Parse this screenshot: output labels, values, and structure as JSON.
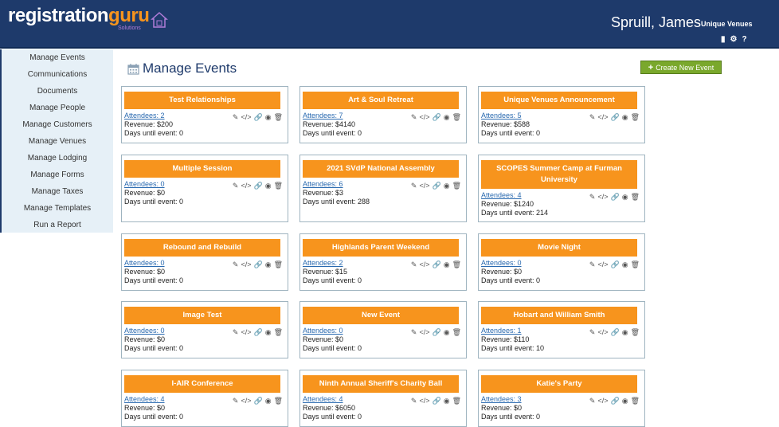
{
  "header": {
    "logo_main": "registration",
    "logo_accent": "guru",
    "logo_sub": "Solutions",
    "user_name": "Spruill, James",
    "organization": "Unique Venues",
    "icons": [
      "document-icon",
      "gear-icon",
      "help-icon"
    ]
  },
  "sidebar": {
    "items": [
      {
        "label": "Manage Events"
      },
      {
        "label": "Communications"
      },
      {
        "label": "Documents"
      },
      {
        "label": "Manage People"
      },
      {
        "label": "Manage Customers"
      },
      {
        "label": "Manage Venues"
      },
      {
        "label": "Manage Lodging"
      },
      {
        "label": "Manage Forms"
      },
      {
        "label": "Manage Taxes"
      },
      {
        "label": "Manage Templates"
      },
      {
        "label": "Run a Report"
      }
    ]
  },
  "main": {
    "title": "Manage Events",
    "create_label": "Create New Event",
    "card_icons": [
      "edit-icon",
      "code-icon",
      "link-icon",
      "binoculars-icon",
      "trash-icon"
    ],
    "events": [
      {
        "title": "Test Relationships",
        "attendees": "Attendees: 2",
        "revenue": "Revenue: $200",
        "days": "Days until event: 0"
      },
      {
        "title": "Art & Soul Retreat",
        "attendees": "Attendees: 7",
        "revenue": "Revenue: $4140",
        "days": "Days until event: 0"
      },
      {
        "title": "Unique Venues Announcement",
        "attendees": "Attendees: 5",
        "revenue": "Revenue: $588",
        "days": "Days until event: 0"
      },
      {
        "title": "Multiple Session",
        "attendees": "Attendees: 0",
        "revenue": "Revenue: $0",
        "days": "Days until event: 0"
      },
      {
        "title": "2021 SVdP National Assembly",
        "attendees": "Attendees: 6",
        "revenue": "Revenue: $3",
        "days": "Days until event: 288"
      },
      {
        "title": "SCOPES Summer Camp at Furman University",
        "attendees": "Attendees: 4",
        "revenue": "Revenue: $1240",
        "days": "Days until event: 214"
      },
      {
        "title": "Rebound and Rebuild",
        "attendees": "Attendees: 0",
        "revenue": "Revenue: $0",
        "days": "Days until event: 0"
      },
      {
        "title": "Highlands Parent Weekend",
        "attendees": "Attendees: 2",
        "revenue": "Revenue: $15",
        "days": "Days until event: 0"
      },
      {
        "title": "Movie Night",
        "attendees": "Attendees: 0",
        "revenue": "Revenue: $0",
        "days": "Days until event: 0"
      },
      {
        "title": "Image Test",
        "attendees": "Attendees: 0",
        "revenue": "Revenue: $0",
        "days": "Days until event: 0"
      },
      {
        "title": "New Event",
        "attendees": "Attendees: 0",
        "revenue": "Revenue: $0",
        "days": "Days until event: 0"
      },
      {
        "title": "Hobart and William Smith",
        "attendees": "Attendees: 1",
        "revenue": "Revenue: $110",
        "days": "Days until event: 10"
      },
      {
        "title": "I-AIR Conference",
        "attendees": "Attendees: 4",
        "revenue": "Revenue: $0",
        "days": "Days until event: 0"
      },
      {
        "title": "Ninth Annual Sheriff's Charity Ball",
        "attendees": "Attendees: 4",
        "revenue": "Revenue: $6050",
        "days": "Days until event: 0"
      },
      {
        "title": "Katie's Party",
        "attendees": "Attendees: 3",
        "revenue": "Revenue: $0",
        "days": "Days until event: 0"
      }
    ]
  },
  "colors": {
    "header_bg": "#1e3a6b",
    "accent_orange": "#f7941d",
    "create_green": "#7aa82c",
    "link_blue": "#2a6ab0",
    "sidebar_bg": "#e6f0f7"
  }
}
